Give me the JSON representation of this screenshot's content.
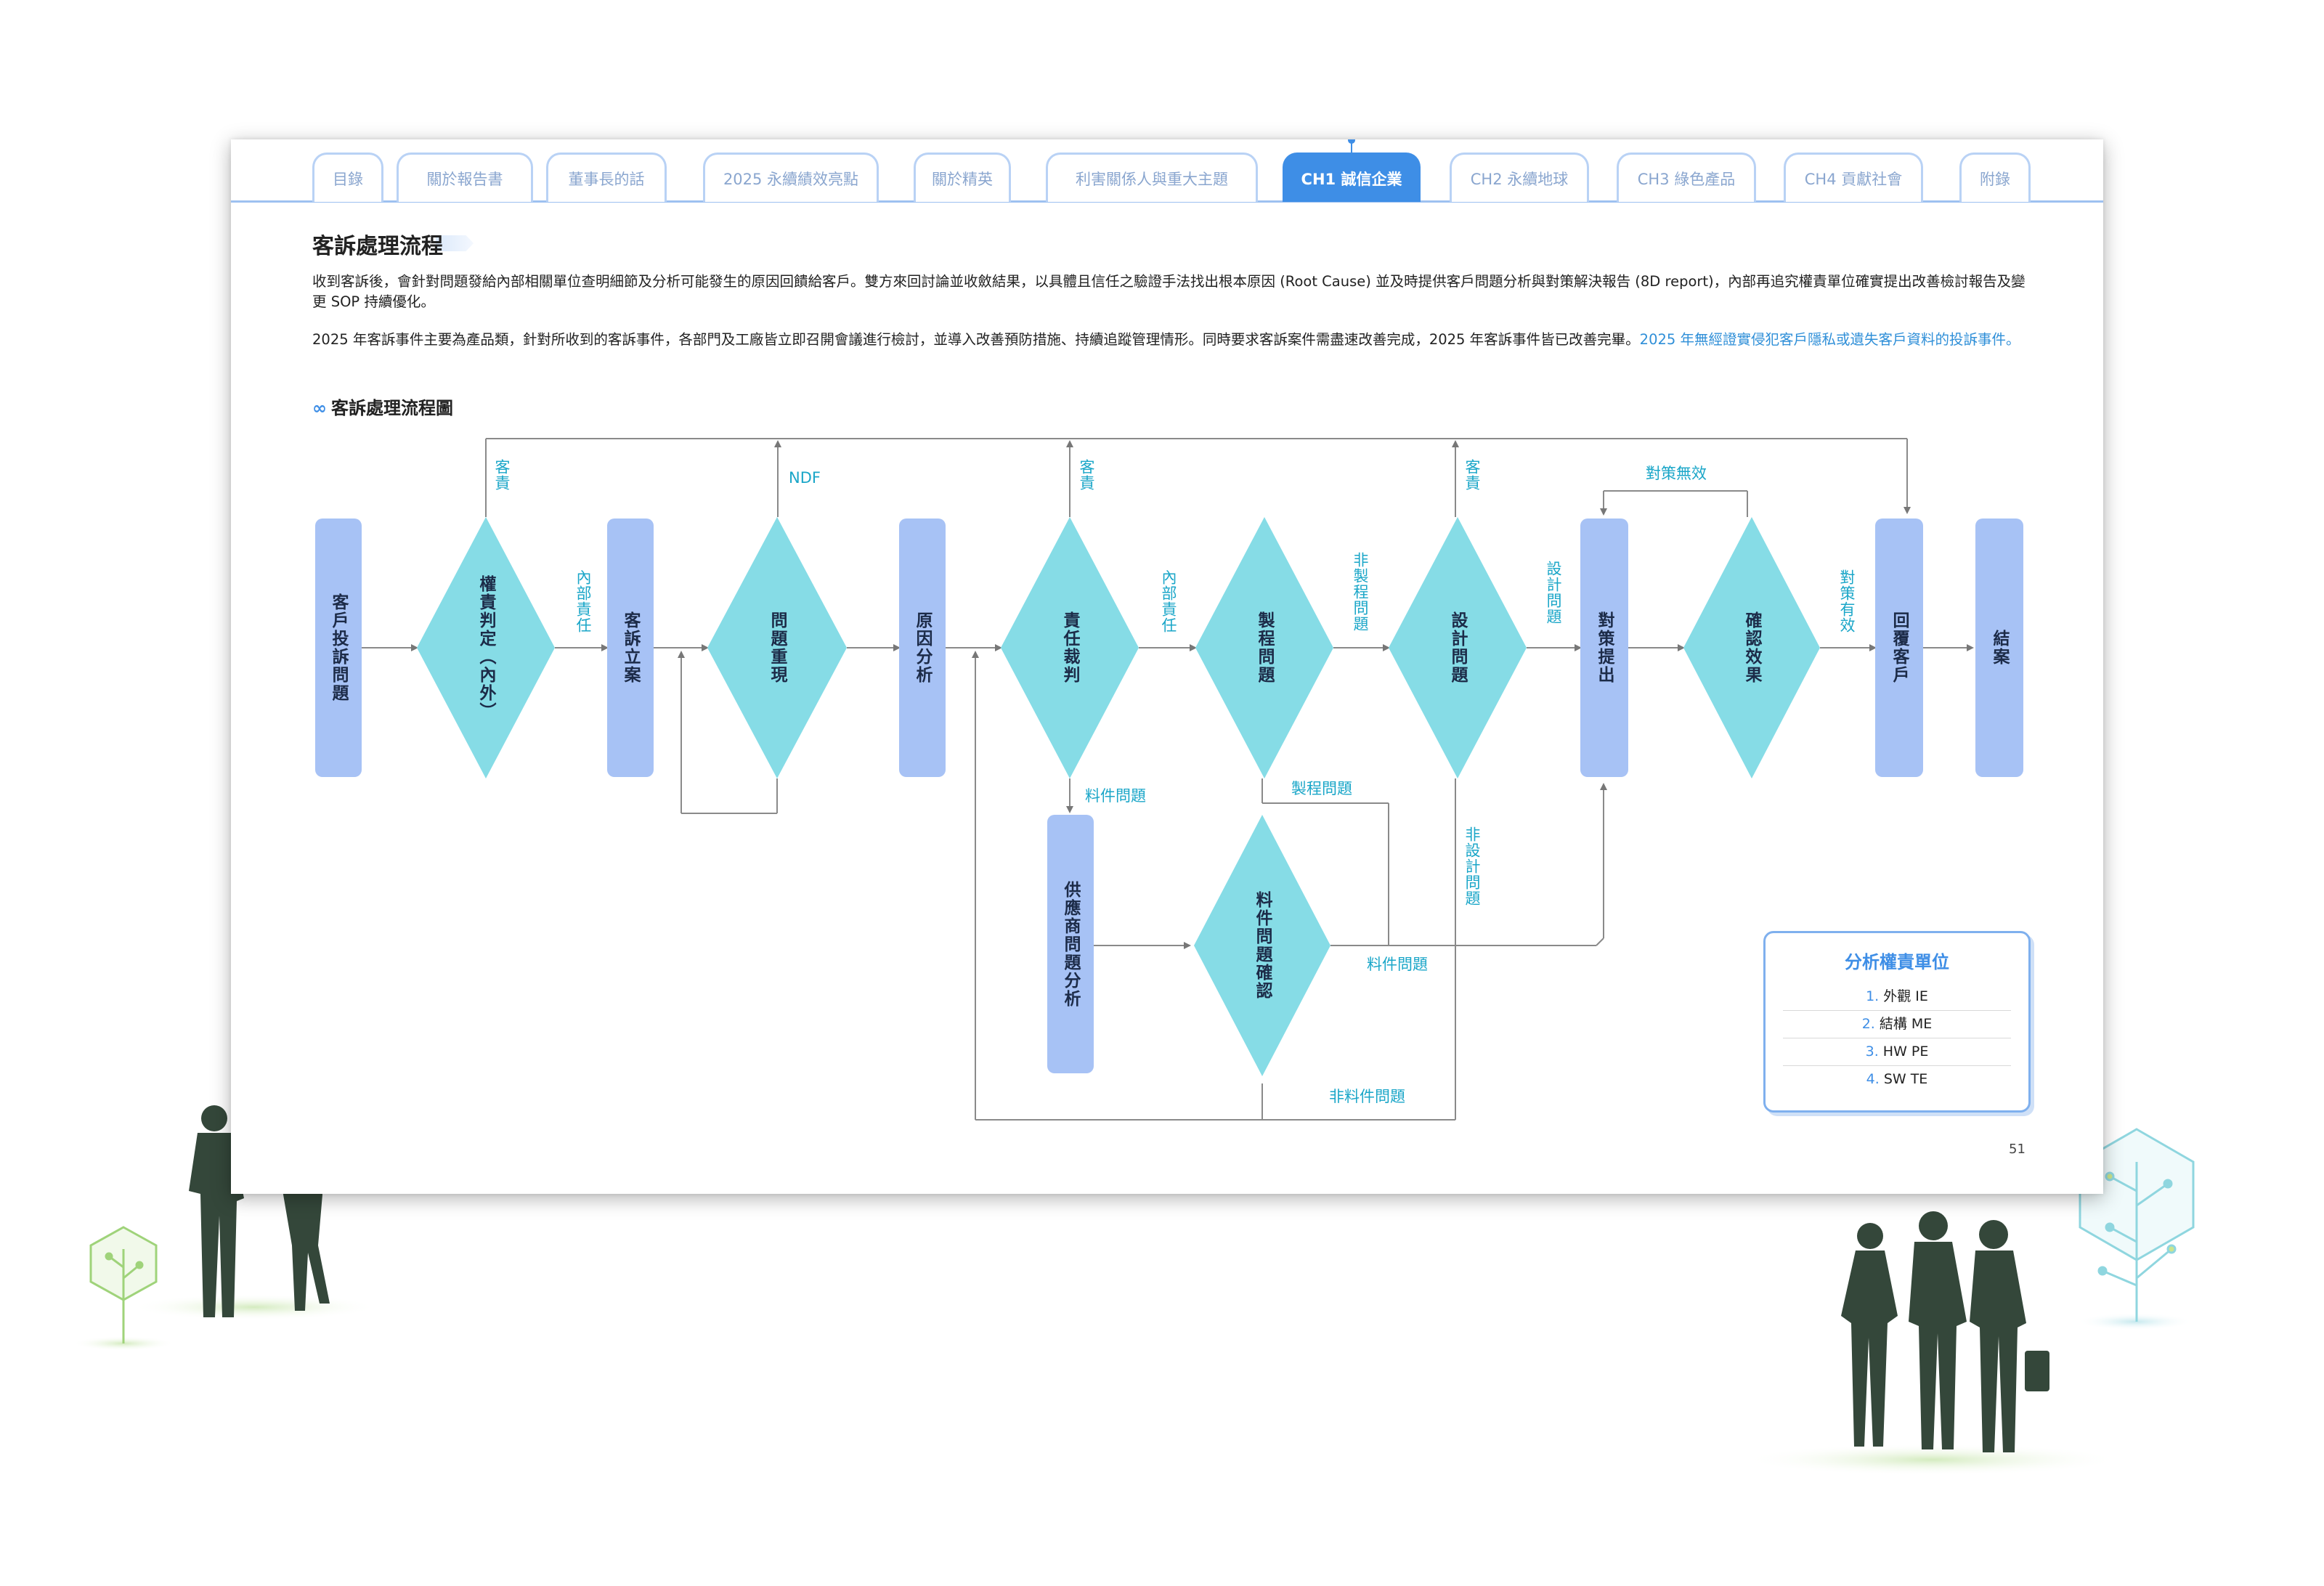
{
  "tabs": [
    {
      "label": "目錄"
    },
    {
      "label": "關於報告書"
    },
    {
      "label": "董事長的話"
    },
    {
      "label": "2025 永續績效亮點"
    },
    {
      "label": "關於精英"
    },
    {
      "label": "利害關係人與重大主題"
    },
    {
      "label": "CH1 誠信企業",
      "active": true
    },
    {
      "label": "CH2 永續地球"
    },
    {
      "label": "CH3 綠色產品"
    },
    {
      "label": "CH4 貢獻社會"
    },
    {
      "label": "附錄"
    }
  ],
  "section_title": "客訴處理流程",
  "paragraph1": "收到客訴後，會針對問題發給內部相關單位查明細節及分析可能發生的原因回饋給客戶。雙方來回討論並收斂結果，以具體且信任之驗證手法找出根本原因 (Root Cause) 並及時提供客戶問題分析與對策解決報告 (8D report)，內部再追究權責單位確實提出改善檢討報告及變更 SOP 持續優化。",
  "paragraph2_main": "2025 年客訴事件主要為產品類，針對所收到的客訴事件，各部門及工廠皆立即召開會議進行檢討，並導入改善預防措施、持續追蹤管理情形。同時要求客訴案件需盡速改善完成，2025 年客訴事件皆已改善完畢。",
  "paragraph2_highlight": "2025 年無經證實侵犯客戶隱私或遺失客戶資料的投訴事件。",
  "diagram_title": "客訴處理流程圖",
  "diagram_title_icon": "infinity-icon",
  "flow": {
    "boxes": {
      "customer_complaint": "客戶投訴問題",
      "case_filing": "客訴立案",
      "root_cause": "原因分析",
      "countermeasure": "對策提出",
      "reply_customer": "回覆客戶",
      "close": "結案",
      "supplier_analysis": "供應商問題分析"
    },
    "diamonds": {
      "responsibility": "權責判定（內外）",
      "reproduce": "問題重現",
      "judgement": "責任裁判",
      "process_issue": "製程問題",
      "design_issue": "設計問題",
      "verify_effect": "確認效果",
      "material_confirm": "料件問題確認"
    },
    "labels": {
      "customer_resp_1": "客責",
      "internal_resp_1": "內部責任",
      "ndf": "NDF",
      "customer_resp_2": "客責",
      "internal_resp_2": "內部責任",
      "non_process": "非製程問題",
      "customer_resp_3": "客責",
      "design_problem": "設計問題",
      "ineffective": "對策無效",
      "effective": "對策有效",
      "material_issue": "料件問題",
      "process_problem": "製程問題",
      "non_design": "非設計問題",
      "material_issue_2": "料件問題",
      "non_material": "非料件問題"
    }
  },
  "legend": {
    "title": "分析權責單位",
    "items": [
      {
        "num": "1.",
        "label": "外觀 IE"
      },
      {
        "num": "2.",
        "label": "結構 ME"
      },
      {
        "num": "3.",
        "label": "HW PE"
      },
      {
        "num": "4.",
        "label": "SW TE"
      }
    ]
  },
  "page_number": "51",
  "colors": {
    "accent": "#3e8ee6",
    "box": "#a7c2f5",
    "diamond": "#86dce6",
    "label": "#1aa6c8",
    "figure": "#34473a"
  }
}
